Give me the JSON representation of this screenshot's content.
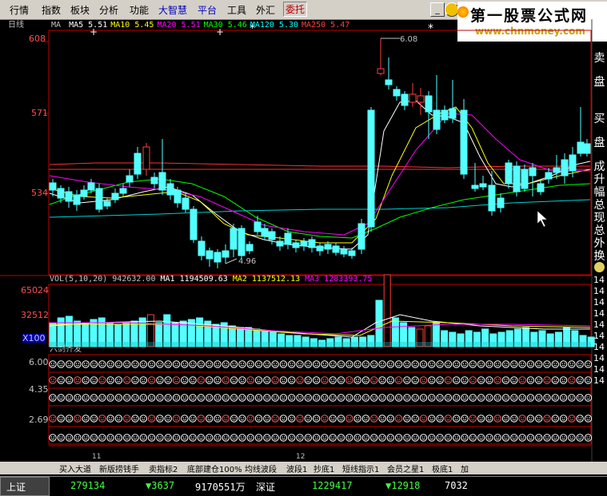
{
  "menu": [
    "行情",
    "指数",
    "板块",
    "分析",
    "功能",
    "大智慧",
    "平台",
    "工具",
    "外汇",
    "委托"
  ],
  "banner": {
    "title": "第一股票公式网",
    "url": "www.chnmoney.com"
  },
  "chart": {
    "period": "日线",
    "ma_label": "MA",
    "ma": [
      {
        "label": "MA5",
        "value": "5.51",
        "color": "#ffffff"
      },
      {
        "label": "MA10",
        "value": "5.45",
        "color": "#ffff00"
      },
      {
        "label": "MA20",
        "value": "5.51",
        "color": "#ff00ff"
      },
      {
        "label": "MA30",
        "value": "5.46",
        "color": "#00ff00"
      },
      {
        "label": "MA120",
        "value": "5.30",
        "color": "#00ffff"
      },
      {
        "label": "MA250",
        "value": "5.47",
        "color": "#ff4040"
      }
    ],
    "y_ticks": [
      "608",
      "571",
      "534"
    ],
    "high_label": "6.08",
    "low_label": "4.96",
    "vol_header": {
      "name": "VOL(5,10,20)",
      "val": "942632.00",
      "ma1": "MA1 1194509.63",
      "ma2": "MA2 1137512.13",
      "ma3": "MA3 1283393.75"
    },
    "vol_ticks": [
      "65024",
      "32512",
      "X100"
    ],
    "indicator_title": "六剑齐发",
    "ind_ticks": [
      "6.00",
      "4.35",
      "2.69"
    ],
    "x_labels": [
      "11",
      "12"
    ],
    "right_buttons": [
      "卖",
      "盘",
      "买",
      "盘",
      "成",
      "升",
      "幅",
      "总",
      "现",
      "总",
      "外",
      "换"
    ],
    "right_nums": [
      "14",
      "14",
      "14",
      "14",
      "14",
      "14",
      "14",
      "14",
      "14",
      "14"
    ]
  },
  "tabs": [
    "买入大道",
    "新版捞钱手",
    "卖指标2",
    "底部建仓100%",
    "均线波段",
    "波段1",
    "抄底1",
    "短线指示1",
    "会员之星1",
    "极底1",
    "加"
  ],
  "status": {
    "idx1": "上证",
    "v1": "279134",
    "ch1": "▼3637",
    "amt1": "9170551万",
    "idx2": "深证",
    "v2": "1229417",
    "ch2": "▼12918",
    "amt2": "7032"
  },
  "colors": {
    "up": "#ff3c3c",
    "down": "#54ffff",
    "axis": "#ff0000",
    "text": "#c0c0c0"
  }
}
